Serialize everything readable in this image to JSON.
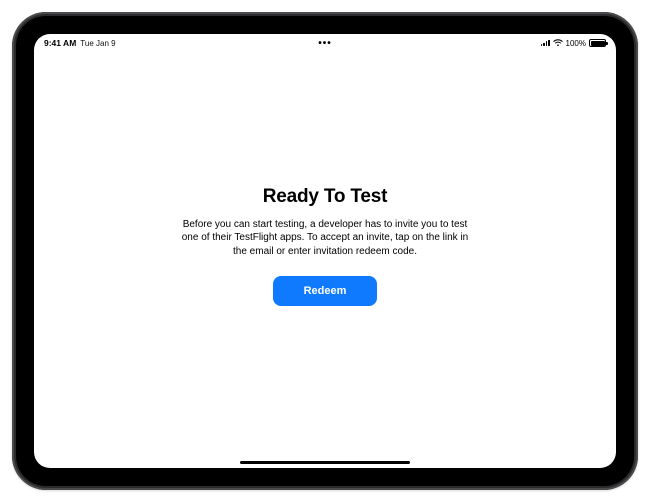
{
  "status": {
    "time": "9:41 AM",
    "date": "Tue Jan 9",
    "multitask_dots": "•••",
    "battery_pct": "100%",
    "signal_icon": "cellular-signal-icon",
    "wifi_icon": "wifi-icon",
    "battery_icon": "battery-full-icon"
  },
  "main": {
    "title": "Ready To Test",
    "body": "Before you can start testing, a developer has to invite you to test one of their TestFlight apps. To accept an invite, tap on the link in the email or enter invitation redeem code.",
    "redeem_label": "Redeem"
  },
  "colors": {
    "accent": "#107aff"
  }
}
